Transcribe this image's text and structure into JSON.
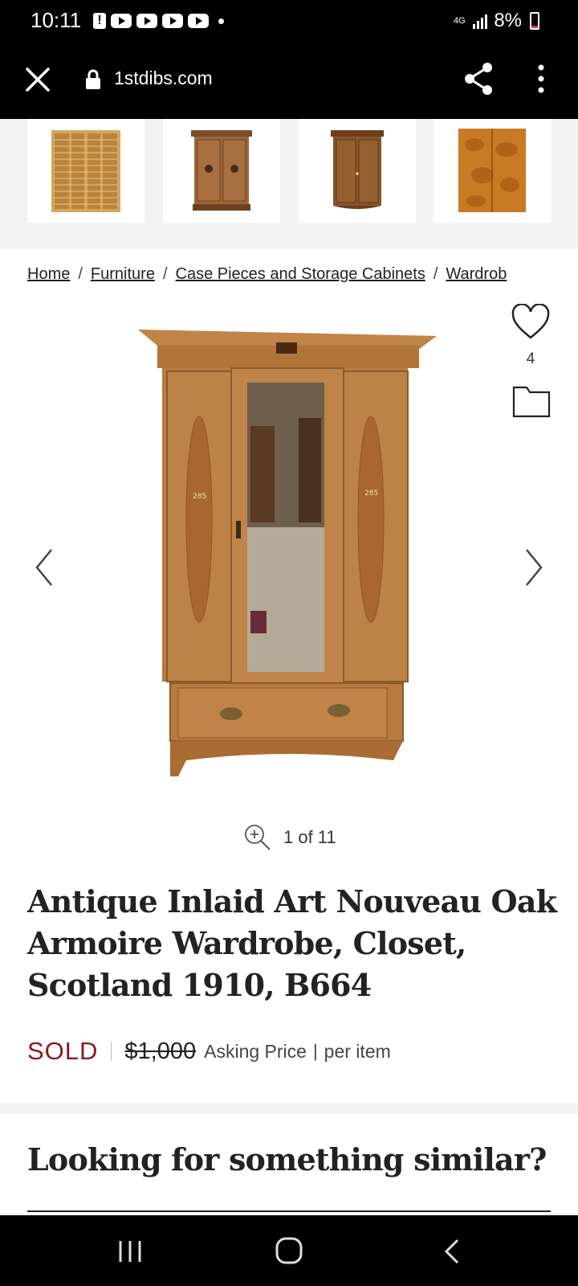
{
  "status_bar": {
    "time": "10:11",
    "network": "4G",
    "battery": "8%",
    "notification_icons": [
      "alert-icon",
      "youtube-icon",
      "youtube-icon",
      "youtube-icon",
      "youtube-icon"
    ]
  },
  "browser": {
    "url": "1stdibs.com"
  },
  "breadcrumb": {
    "items": [
      "Home",
      "Furniture",
      "Case Pieces and Storage Cabinets",
      "Wardrob"
    ],
    "separator": "/"
  },
  "product": {
    "favorites_count": "4",
    "image_counter": "1 of 11",
    "title": "Antique Inlaid Art Nouveau Oak Armoire Wardrobe, Closet, Scotland 1910, B664",
    "status": "SOLD",
    "price": "$1,000",
    "price_label": "Asking Price",
    "price_unit": "per item",
    "price_unit_separator": "|"
  },
  "similar": {
    "heading": "Looking for something similar?"
  },
  "colors": {
    "sold": "#8b1a1a",
    "wood": "#b77a40",
    "wood_dark": "#8a5a2c"
  }
}
